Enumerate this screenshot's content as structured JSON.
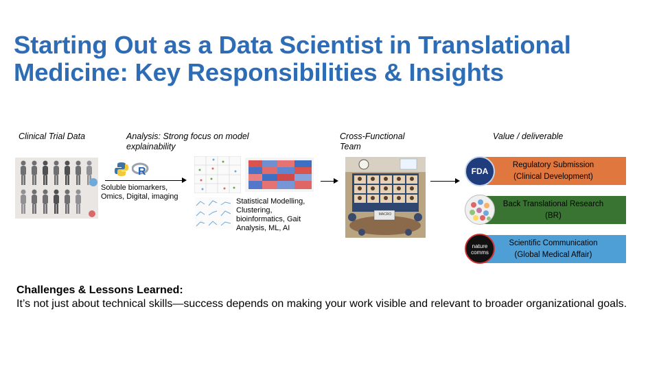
{
  "title": "Starting Out as a Data Scientist in Translational Medicine: Key Responsibilities & Insights",
  "flow": {
    "col1_header": "Clinical Trial Data",
    "col2_header": "Analysis: Strong focus on model explainability",
    "col3_header": "Cross-Functional Team",
    "col4_header": "Value / deliverable",
    "data_types": "Soluble biomarkers, Omics, Digital, imaging",
    "methods": "Statistical Modelling, Clustering, bioinformatics, Gait Analysis, ML, AI",
    "python_icon": "python-logo-icon",
    "r_icon": "r-logo-icon"
  },
  "deliverables": [
    {
      "line1": "Regulatory Submission",
      "line2": "(Clinical Development)",
      "logo_text": "FDA",
      "color": "#e0773e"
    },
    {
      "line1": "Back Translational Research",
      "line2": "(BR)",
      "logo_text": "",
      "color": "#3a7432"
    },
    {
      "line1": "Scientific Communication",
      "line2": "(Global Medical Affair)",
      "logo_text": "nature comms",
      "color": "#4f9fd7"
    }
  ],
  "meeting_screen_text": "MACRO",
  "challenges": {
    "heading": "Challenges & Lessons Learned:",
    "body": "It’s not just about technical skills—success depends on making your work visible and relevant to broader organizational goals."
  }
}
